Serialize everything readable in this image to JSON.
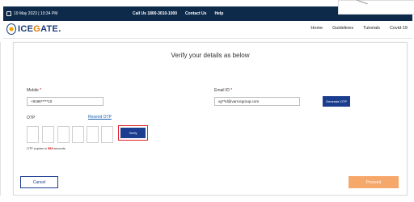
{
  "topbar": {
    "date": "19 May 2023 | 10:34 PM",
    "call_us": "Call Us 1800-3010-1000",
    "contact_us": "Contact Us",
    "help": "Help",
    "font_small": "A",
    "font_normal": "A",
    "font_large": "A+",
    "language": "ENG"
  },
  "header": {
    "logo_text_pre": "ICE",
    "logo_text_mid": "G",
    "logo_text_post": "ATE.",
    "nav": [
      "Home",
      "Guidelines",
      "Tutorials",
      "Covid-19"
    ]
  },
  "form": {
    "title": "Verify your details as below",
    "mobile_label": "Mobile",
    "mobile_value": "+9196*****10",
    "email_label": "Email ID",
    "email_value": "vg**id@varrocgroup.com",
    "required_mark": "*",
    "generate_otp": "Generate OTP",
    "otp_label": "OTP",
    "resend_otp": "Resend OTP",
    "verify": "Verify",
    "expiry_prefix": "OTP expires in",
    "expiry_seconds": "593",
    "expiry_suffix": "seconds",
    "cancel": "Cancel",
    "proceed": "Proceed"
  },
  "colors": {
    "topbar_bg": "#0d2a4a",
    "primary": "#1b3d8f",
    "proceed": "#f6a76a",
    "highlight": "#e0202a"
  }
}
